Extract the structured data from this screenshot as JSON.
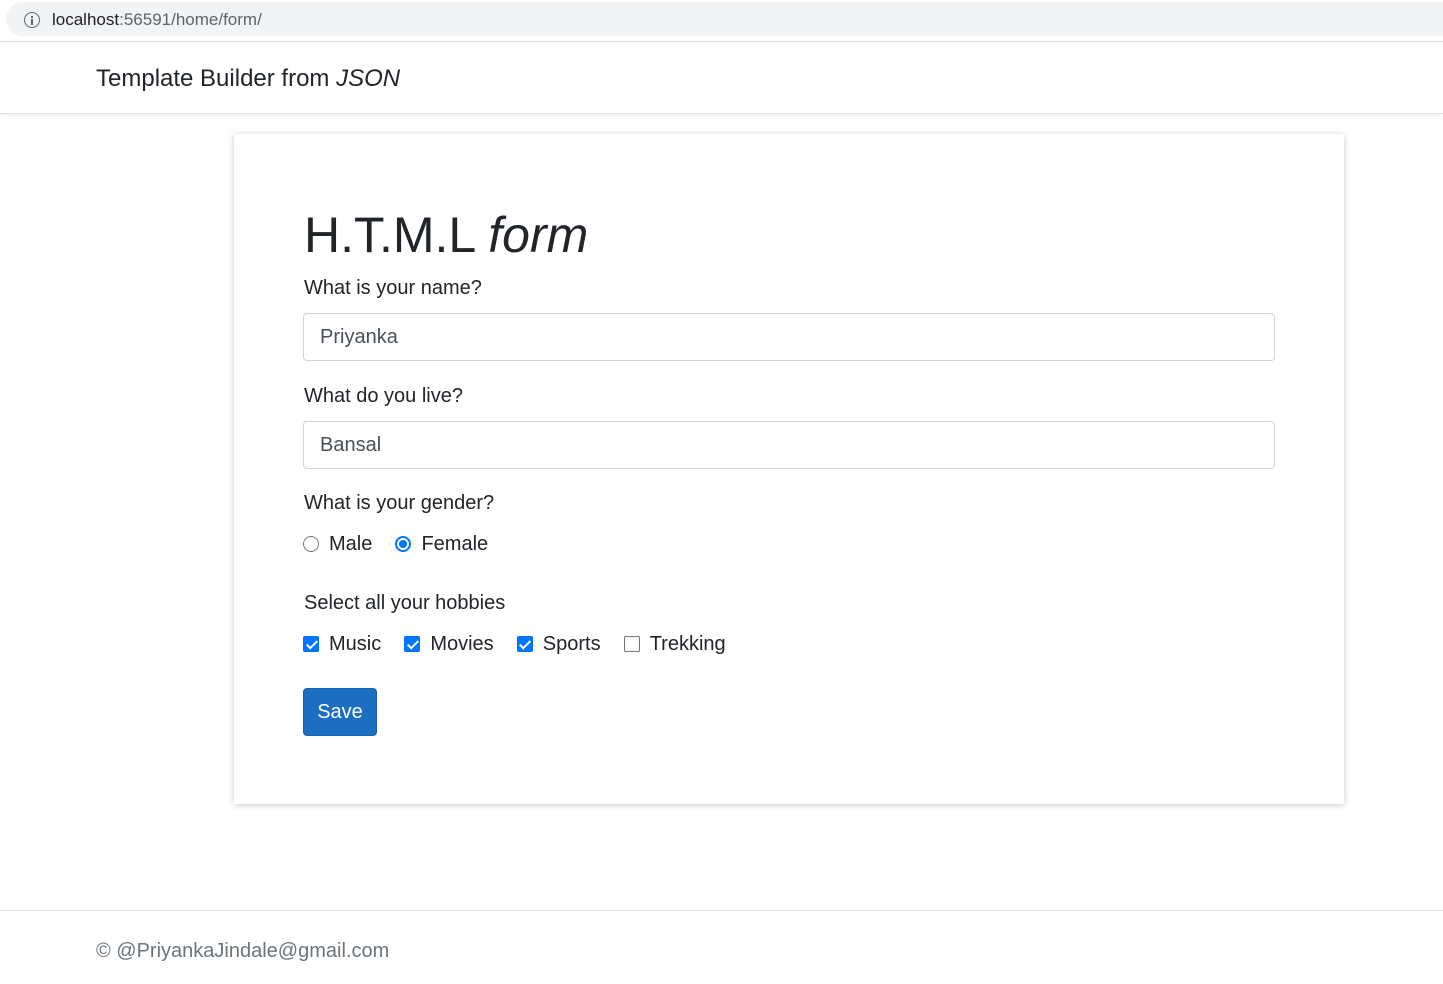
{
  "browser": {
    "url_host": "localhost",
    "url_rest": ":56591/home/form/"
  },
  "navbar": {
    "brand_main": "Template Builder from ",
    "brand_em": "JSON"
  },
  "form": {
    "title_main": "H.T.M.L ",
    "title_em": "form",
    "name_label": "What is your name?",
    "name_value": "Priyanka",
    "live_label": "What do you live?",
    "live_value": "Bansal",
    "gender_label": "What is your gender?",
    "gender_options": [
      {
        "label": "Male",
        "checked": false
      },
      {
        "label": "Female",
        "checked": true
      }
    ],
    "hobbies_label": "Select all your hobbies",
    "hobbies_options": [
      {
        "label": "Music",
        "checked": true
      },
      {
        "label": "Movies",
        "checked": true
      },
      {
        "label": "Sports",
        "checked": true
      },
      {
        "label": "Trekking",
        "checked": false
      }
    ],
    "save_label": "Save"
  },
  "footer": {
    "text": "© @PriyankaJindale@gmail.com"
  },
  "colors": {
    "accent": "#0075ff",
    "button": "#1b6ec2"
  }
}
